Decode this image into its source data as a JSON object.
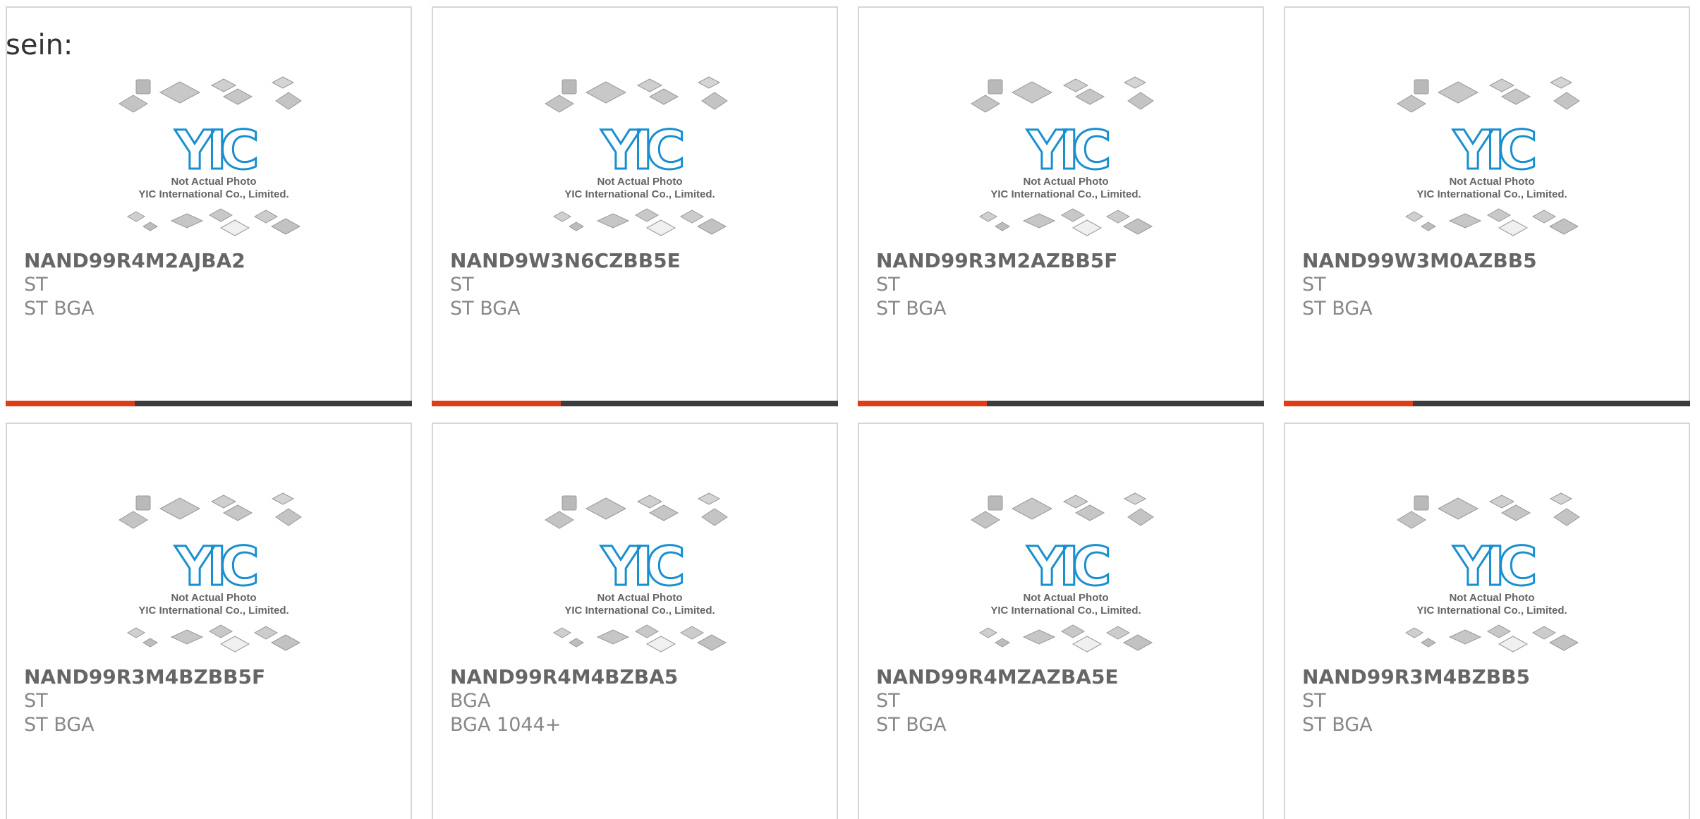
{
  "heading": "sein:",
  "colors": {
    "accent": "#e03c16",
    "bar": "#3c3c3c",
    "card_border": "#d6d6d6",
    "logo_blue": "#1a8fd0"
  },
  "photo_placeholder": {
    "caption_line1": "Not Actual Photo",
    "caption_line2": "YIC International Co., Limited.",
    "logo_text": "YIC"
  },
  "products": [
    {
      "part": "NAND99R4M2AJBA2",
      "maker": "ST",
      "package": "ST BGA"
    },
    {
      "part": "NAND9W3N6CZBB5E",
      "maker": "ST",
      "package": "ST BGA"
    },
    {
      "part": "NAND99R3M2AZBB5F",
      "maker": "ST",
      "package": "ST BGA"
    },
    {
      "part": "NAND99W3M0AZBB5",
      "maker": "ST",
      "package": "ST BGA"
    },
    {
      "part": "NAND99R3M4BZBB5F",
      "maker": "ST",
      "package": "ST BGA"
    },
    {
      "part": "NAND99R4M4BZBA5",
      "maker": "BGA",
      "package": "BGA 1044+"
    },
    {
      "part": "NAND99R4MZAZBA5E",
      "maker": "ST",
      "package": "ST BGA"
    },
    {
      "part": "NAND99R3M4BZBB5",
      "maker": "ST",
      "package": "ST BGA"
    }
  ]
}
